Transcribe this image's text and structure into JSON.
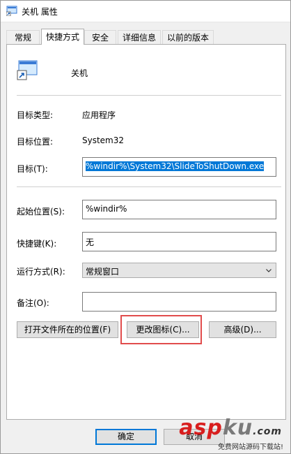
{
  "window": {
    "title": "关机 属性",
    "title_icon": "shortcut-icon"
  },
  "tabs": [
    {
      "label": "常规",
      "active": false
    },
    {
      "label": "快捷方式",
      "active": true
    },
    {
      "label": "安全",
      "active": false
    },
    {
      "label": "详细信息",
      "active": false
    },
    {
      "label": "以前的版本",
      "active": false
    }
  ],
  "header": {
    "name": "关机",
    "icon": "shortcut-icon"
  },
  "fields": {
    "target_type_label": "目标类型:",
    "target_type_value": "应用程序",
    "target_location_label": "目标位置:",
    "target_location_value": "System32",
    "target_label": "目标(T):",
    "target_value": "%windir%\\System32\\SlideToShutDown.exe",
    "start_in_label": "起始位置(S):",
    "start_in_value": "%windir%",
    "shortcut_key_label": "快捷键(K):",
    "shortcut_key_value": "无",
    "run_label": "运行方式(R):",
    "run_value": "常规窗口",
    "comment_label": "备注(O):",
    "comment_value": ""
  },
  "buttons": {
    "open_location": "打开文件所在的位置(F)",
    "change_icon": "更改图标(C)...",
    "advanced": "高级(D)..."
  },
  "footer": {
    "ok": "确定",
    "cancel": "取消"
  },
  "watermark": {
    "brand_red": "asp",
    "brand_gray": "ku",
    "tld": ".com",
    "subtitle": "免费网站源码下载站!"
  },
  "colors": {
    "selection": "#0078d7",
    "highlight_box": "#e14c4c",
    "watermark_red": "#d81e1e"
  }
}
